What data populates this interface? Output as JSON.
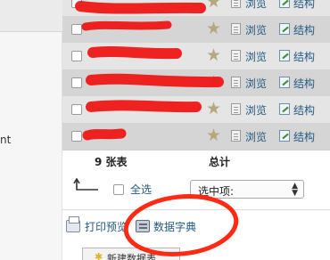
{
  "left_panel": {
    "fragment_text": "nt"
  },
  "rows": [
    {
      "name": "",
      "browse": "浏览",
      "structure": "结构"
    },
    {
      "name": "",
      "browse": "浏览",
      "structure": "结构"
    },
    {
      "name": "",
      "browse": "浏览",
      "structure": "结构"
    },
    {
      "name": "",
      "browse": "浏览",
      "structure": "结构"
    },
    {
      "name": "",
      "browse": "浏览",
      "structure": "结构"
    },
    {
      "name": "",
      "browse": "浏览",
      "structure": "结构"
    }
  ],
  "summary": {
    "table_count": "9 张表",
    "total_label": "总计"
  },
  "controls": {
    "select_all_label": "全选",
    "with_selected_value": "选中项:"
  },
  "actions": {
    "print_view_label": "打印预览",
    "data_dictionary_label": "数据字典",
    "new_table_label": "新建数据表"
  },
  "colors": {
    "link": "#235a81",
    "row_odd": "#e5e5e5",
    "row_even": "#d5d5d5",
    "redaction": "#f01818",
    "annotation_circle": "#ff2a14"
  },
  "icons": {
    "favorite": "star-icon",
    "browse": "browse-icon",
    "structure": "structure-icon",
    "print": "print-icon",
    "dictionary": "data-dictionary-icon",
    "new_table": "new-table-icon"
  }
}
